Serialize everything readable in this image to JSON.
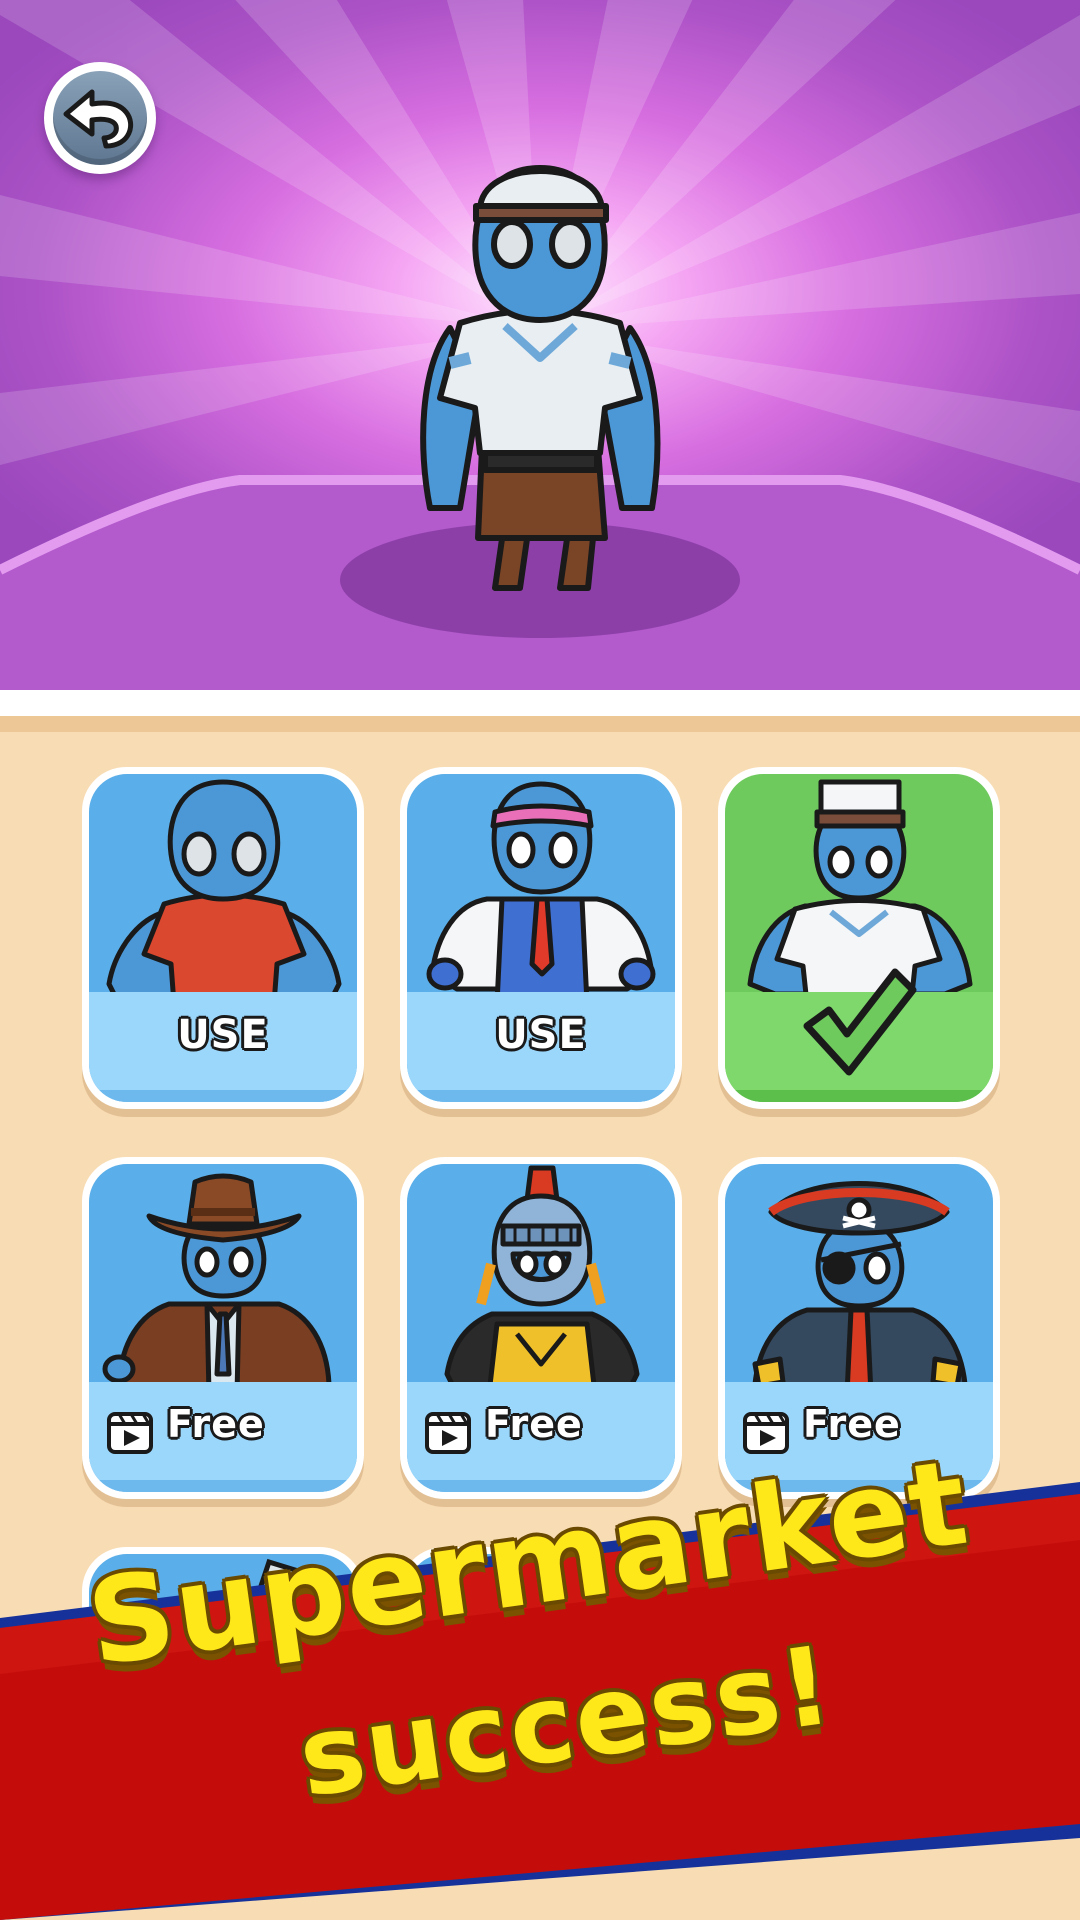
{
  "header": {
    "back_icon": "undo-arrow-icon"
  },
  "hero": {
    "character": "blue-stickman-cashier-outfit"
  },
  "skins": [
    {
      "label": "USE",
      "state": "owned",
      "outfit": "red-tshirt"
    },
    {
      "label": "USE",
      "state": "owned",
      "outfit": "office-headband"
    },
    {
      "label": "",
      "state": "selected",
      "outfit": "cashier-cap",
      "badge": "checkmark-icon"
    },
    {
      "label": "Free",
      "state": "ad-unlock",
      "outfit": "cowboy",
      "icon": "video-ad-icon"
    },
    {
      "label": "Free",
      "state": "ad-unlock",
      "outfit": "knight-helmet",
      "icon": "video-ad-icon"
    },
    {
      "label": "Free",
      "state": "ad-unlock",
      "outfit": "pirate",
      "icon": "video-ad-icon"
    }
  ],
  "banner": {
    "line1": "Supermarket",
    "line2": "success!"
  },
  "colors": {
    "hero_purple": "#ab52c6",
    "card_blue": "#5aaee9",
    "card_green": "#6fca5e",
    "banner_red": "#c40d0b",
    "banner_yellow": "#ffe81a",
    "panel_tan": "#f8dcb4"
  }
}
